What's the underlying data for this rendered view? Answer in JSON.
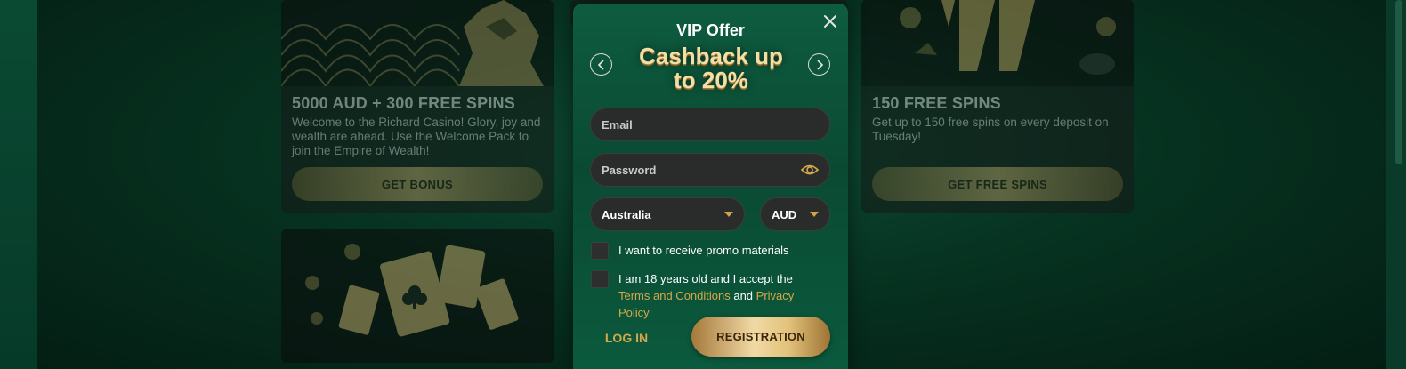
{
  "cards": [
    {
      "title": "5000 AUD + 300 FREE SPINS",
      "description": "Welcome to the Richard Casino! Glory, joy and wealth are ahead. Use the Welcome Pack to join the Empire of Wealth!",
      "button": "GET BONUS"
    },
    {
      "title": "150 FREE SPINS",
      "description": "Get up to 150 free spins on every deposit on Tuesday!",
      "button": "GET FREE SPINS"
    }
  ],
  "modal": {
    "title": "VIP Offer",
    "headline": "Cashback up to 20%",
    "email_placeholder": "Email",
    "password_placeholder": "Password",
    "country": "Australia",
    "currency": "AUD",
    "promo_checkbox_label": "I want to receive promo materials",
    "terms_prefix": "I am 18 years old and I accept the ",
    "terms_link": "Terms and Conditions",
    "terms_and": " and ",
    "privacy_link": "Privacy Policy",
    "login_label": "LOG IN",
    "register_label": "REGISTRATION"
  },
  "colors": {
    "accent_gold": "#d6a84a",
    "modal_green": "#0a4a33",
    "field_bg": "#2a2c2b"
  }
}
